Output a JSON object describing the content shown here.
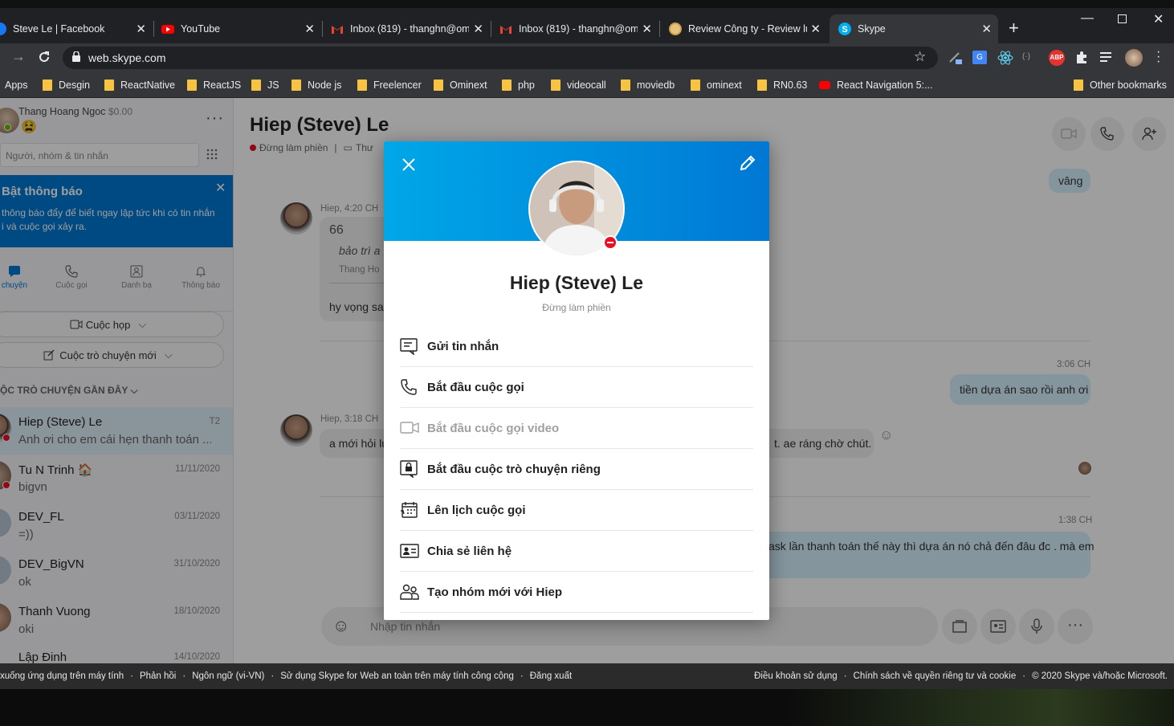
{
  "browser": {
    "tabs": [
      {
        "title": "Steve Le | Facebook",
        "icon": "facebook-icon"
      },
      {
        "title": "YouTube",
        "icon": "youtube-icon"
      },
      {
        "title": "Inbox (819) - thanghn@om",
        "icon": "gmail-icon"
      },
      {
        "title": "Inbox (819) - thanghn@om",
        "icon": "gmail-icon"
      },
      {
        "title": "Review Công ty - Review lư",
        "icon": "review-icon"
      },
      {
        "title": "Skype",
        "icon": "skype-icon"
      }
    ],
    "url": "web.skype.com",
    "bookmarks": [
      "Apps",
      "Desgin",
      "ReactNative",
      "ReactJS",
      "JS",
      "Node js",
      "Freelencer",
      "Ominext",
      "php",
      "videocall",
      "moviedb",
      "ominext",
      "RN0.63",
      "React Navigation 5:..."
    ],
    "other_bookmarks": "Other bookmarks"
  },
  "sidebar": {
    "profile_name": "Thang Hoang Ngoc",
    "credit": "$0.00",
    "search_placeholder": "Người, nhóm & tin nhắn",
    "banner_title": "Bật thông báo",
    "banner_text_1": "thông báo đẩy để biết ngay lập tức khi có tin nhắn",
    "banner_text_2": "i và cuộc gọi xảy ra.",
    "nav": [
      "chuyện",
      "Cuộc gọi",
      "Danh bạ",
      "Thông báo"
    ],
    "meeting_btn": "Cuộc họp",
    "new_chat_btn": "Cuộc trò chuyện mới",
    "recent_header": "ỘC TRÒ CHUYỆN GẦN ĐÂY",
    "conversations": [
      {
        "name": "Hiep (Steve) Le",
        "msg": "Anh ơi cho em cái hẹn thanh toán ...",
        "date": "T2"
      },
      {
        "name": "Tu N Trinh 🏠",
        "msg": "bigvn",
        "date": "11/11/2020"
      },
      {
        "name": "DEV_FL",
        "msg": "=))",
        "date": "03/11/2020"
      },
      {
        "name": "DEV_BigVN",
        "msg": "ok",
        "date": "31/10/2020"
      },
      {
        "name": "Thanh Vuong",
        "msg": "oki",
        "date": "18/10/2020"
      },
      {
        "name": "Lập Đinh",
        "msg": "",
        "date": "14/10/2020"
      }
    ]
  },
  "chat": {
    "title": "Hiep (Steve) Le",
    "status": "Đừng làm phiền",
    "sep": "|",
    "gallery": "Thư",
    "msg_vang": "vâng",
    "m1_meta": "Hiep, 4:20 CH",
    "m1_quote_mark": "66",
    "m1_quote": "bảo trì a",
    "m1_quote_author": "Thang Ho",
    "m1_text": "hy vọng sau",
    "time_306": "3:06 CH",
    "my_msg_1": "tiền dựa án sao rồi anh ơi",
    "m2_meta": "Hiep, 3:18 CH",
    "m2_text_left": "a mới hỏi lu",
    "m2_text_right": "t. ae ráng chờ chút.",
    "time_138": "1:38 CH",
    "my_msg_2": "ask lần thanh toán thế này thì dựa án nó chả đến đâu đc . mà em",
    "input_placeholder": "Nhập tin nhắn"
  },
  "modal": {
    "name": "Hiep (Steve) Le",
    "status": "Đừng làm phiền",
    "actions": [
      {
        "label": "Gửi tin nhắn",
        "icon": "message-icon",
        "enabled": true
      },
      {
        "label": "Bắt đầu cuộc gọi",
        "icon": "phone-icon",
        "enabled": true
      },
      {
        "label": "Bắt đầu cuộc gọi video",
        "icon": "video-icon",
        "enabled": false
      },
      {
        "label": "Bắt đầu cuộc trò chuyện riêng",
        "icon": "lock-chat-icon",
        "enabled": true
      },
      {
        "label": "Lên lịch cuộc gọi",
        "icon": "calendar-icon",
        "enabled": true
      },
      {
        "label": "Chia sẻ liên hệ",
        "icon": "contact-card-icon",
        "enabled": true
      },
      {
        "label": "Tạo nhóm mới với Hiep",
        "icon": "group-icon",
        "enabled": true
      }
    ]
  },
  "footer": {
    "left": [
      "xuống ứng dụng trên máy tính",
      "Phản hồi",
      "Ngôn ngữ (vi-VN)",
      "Sử dụng Skype for Web an toàn trên máy tính công cộng",
      "Đăng xuất"
    ],
    "right": [
      "Điều khoản sử dụng",
      "Chính sách về quyền riêng tư và cookie",
      "© 2020 Skype và/hoặc Microsoft."
    ]
  },
  "colors": {
    "skype_blue": "#0078d4",
    "dnd_red": "#e81123",
    "tab_bg": "#202124",
    "active_tab": "#35363a"
  }
}
